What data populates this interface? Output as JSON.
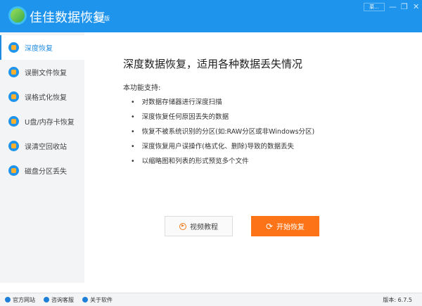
{
  "header": {
    "app_name": "佳佳数据恢复",
    "edition": "专业版",
    "menu_label": "菜...",
    "minimize": "—",
    "maximize": "❐",
    "close": "✕"
  },
  "sidebar": {
    "items": [
      {
        "label": "深度恢复"
      },
      {
        "label": "误删文件恢复"
      },
      {
        "label": "误格式化恢复"
      },
      {
        "label": "U盘/内存卡恢复"
      },
      {
        "label": "误清空回收站"
      },
      {
        "label": "磁盘分区丢失"
      }
    ]
  },
  "main": {
    "title": "深度数据恢复，适用各种数据丢失情况",
    "features_label": "本功能支持:",
    "features": [
      "对数据存储器进行深度扫描",
      "深度恢复任何原因丢失的数据",
      "恢复不被系统识别的分区(如:RAW分区或非Windows分区)",
      "深度恢复用户误操作(格式化、删除)导致的数据丢失",
      "以缩略图和列表的形式预览多个文件"
    ],
    "tutorial_button": "视频教程",
    "start_button": "开始恢复"
  },
  "footer": {
    "links": [
      "官方网站",
      "咨询客服",
      "关于软件"
    ],
    "version": "版本: 6.7.5"
  }
}
